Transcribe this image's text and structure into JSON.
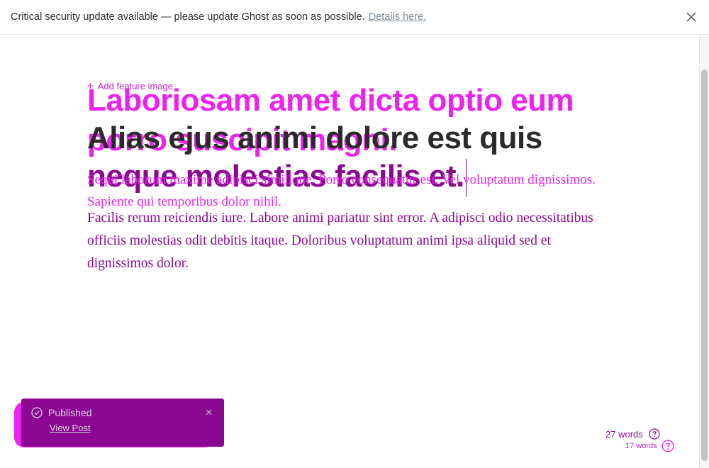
{
  "banner": {
    "message": "Critical security update available — please update Ghost as soon as possible.",
    "link": "Details here."
  },
  "editor": {
    "add_feature_image": "Add feature image",
    "title_ghost": "Laboriosam amet dicta optio eum porro suscipit magni.",
    "title_part1": "Alias ejus animi dolore est quis",
    "title_part2": "neque molestias facilis et.",
    "body_ghost": "Sequi laborum maxime adipisci similique. Porro consequatur est. Vel voluptatum dignissimos. Sapiente qui temporibus dolor nihil.",
    "body_main": "Facilis rerum reiciendis iure. Labore animi pariatur sint error. A adipisci odio necessitatibus officiis molestias odit debitis itaque. Doloribus voluptatum animi ipsa aliquid sed et dignissimos dolor."
  },
  "toast": {
    "status": "Published",
    "link": "View Post"
  },
  "word_count": {
    "primary": "27 words",
    "secondary": "17 words"
  },
  "colors": {
    "accent_dark": "#8b0893",
    "accent_light": "#ee22f0"
  }
}
